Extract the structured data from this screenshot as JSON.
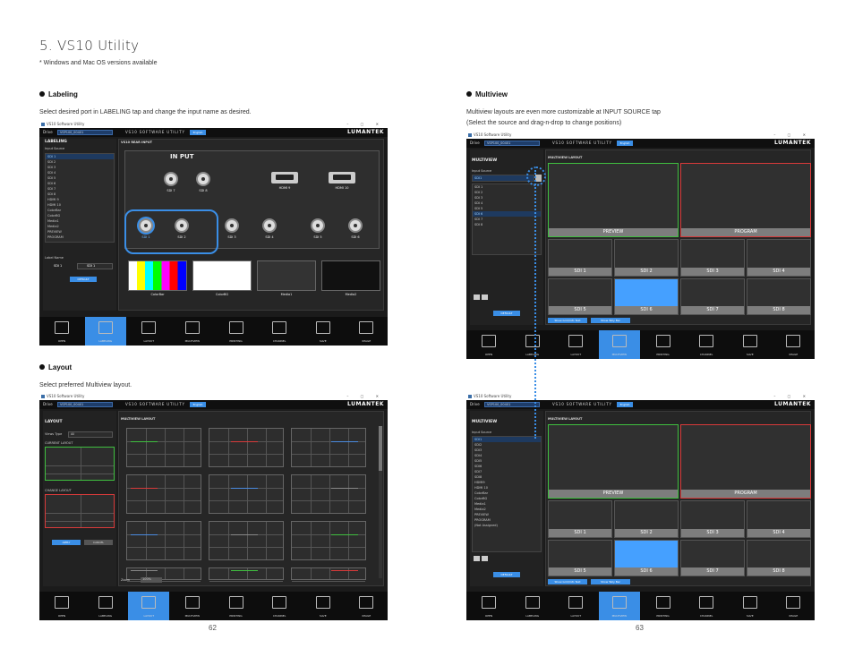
{
  "page": {
    "title": "5. VS10 Utility",
    "note": "* Windows and Mac OS versions available",
    "page_left": "62",
    "page_right": "63"
  },
  "sections": {
    "labeling": {
      "heading": "Labeling",
      "desc": "Select desired port in LABELING tap and change the input name as desired."
    },
    "multiview": {
      "heading": "Multiview",
      "desc1": "Multiview layouts are even more customizable at INPUT SOURCE tap",
      "desc2": "(Select the source and drag-n-drop to change positions)"
    },
    "layout": {
      "heading": "Layout",
      "desc": "Select preferred Multiview layout."
    }
  },
  "app": {
    "window_title": "VS10 Software Utility",
    "device_label": "Drive",
    "device_value": "VSP100_00401",
    "app_name": "VS10 SOFTWARE UTILITY",
    "lang_btn": "English",
    "brand": "LUMANTEK",
    "win_controls": "–  ▢  ✕",
    "nav": [
      "OPEN",
      "LABELING",
      "LAYOUT",
      "MULTIVIEW",
      "PRINTING",
      "CHANNEL",
      "SAVE",
      "IMAGE"
    ]
  },
  "labeling": {
    "panel_title": "LABELING",
    "input_source": "Input Source",
    "main_title": "VS10 REAR INPUT",
    "input_heading": "IN PUT",
    "items": [
      "SDI 1",
      "SDI 2",
      "SDI 3",
      "SDI 4",
      "SDI 5",
      "SDI 6",
      "SDI 7",
      "SDI 8",
      "HDMI 9",
      "HDMI 10",
      "ColorBar",
      "ColorBG",
      "Media1",
      "Media2",
      "PREVIEW",
      "PROGRAM"
    ],
    "label_name": "Label Name",
    "label_from": "SDI 1",
    "label_to": "SDI 1",
    "default_btn": "DEFAULT",
    "top_row": [
      "SDI 7",
      "SDI 8",
      "HDMI 9",
      "HDMI 10"
    ],
    "bottom_row": [
      "SDI 1",
      "SDI 2",
      "SDI 3",
      "SDI 4",
      "SDI 5",
      "SDI 6"
    ],
    "sources": [
      "ColorBar",
      "ColorBG",
      "Media1",
      "Media2"
    ]
  },
  "multiview": {
    "panel_title": "MULTIVIEW",
    "input_source": "Input Source",
    "selected": "SDI1",
    "main_title": "MULTIVIEW LAYOUT",
    "items": [
      "SDI 1",
      "SDI 2",
      "SDI 3",
      "SDI 4",
      "SDI 5",
      "SDI 6",
      "SDI 7",
      "SDI 8"
    ],
    "items_long": [
      "SDI1",
      "SDI2",
      "SDI3",
      "SDI4",
      "SDI5",
      "SDI6",
      "SDI7",
      "SDI8",
      "HDMI9",
      "HDMI 10",
      "ColorBar",
      "ColorBG",
      "Media1",
      "Media2",
      "PREVIEW",
      "PROGRAM",
      "(Not Assigned)"
    ],
    "default_btn": "DEFAULT",
    "btn_a": "Show Grid/Info Text",
    "btn_b": "Show Tally Bar",
    "tiles": {
      "preview": "PREVIEW",
      "program": "PROGRAM",
      "small": [
        "SDI 1",
        "SDI 2",
        "SDI 3",
        "SDI 4",
        "SDI 5",
        "SDI 6",
        "SDI 7",
        "SDI 8"
      ]
    }
  },
  "layout": {
    "panel_title": "LAYOUT",
    "view_type": "Views Type",
    "view_value": "All",
    "current": "CURRENT LAYOUT",
    "change": "CHANGE LAYOUT",
    "apply": "APPLY",
    "cancel": "CANCEL",
    "main_title": "MULTIVIEW LAYOUT",
    "zoom": "Zoom",
    "zoom_value": "100%"
  },
  "colors": {
    "accent": "#3a8ee6",
    "preview": "#3fbf3f",
    "program": "#d83a3a",
    "selected_tile": "#45a0ff"
  }
}
